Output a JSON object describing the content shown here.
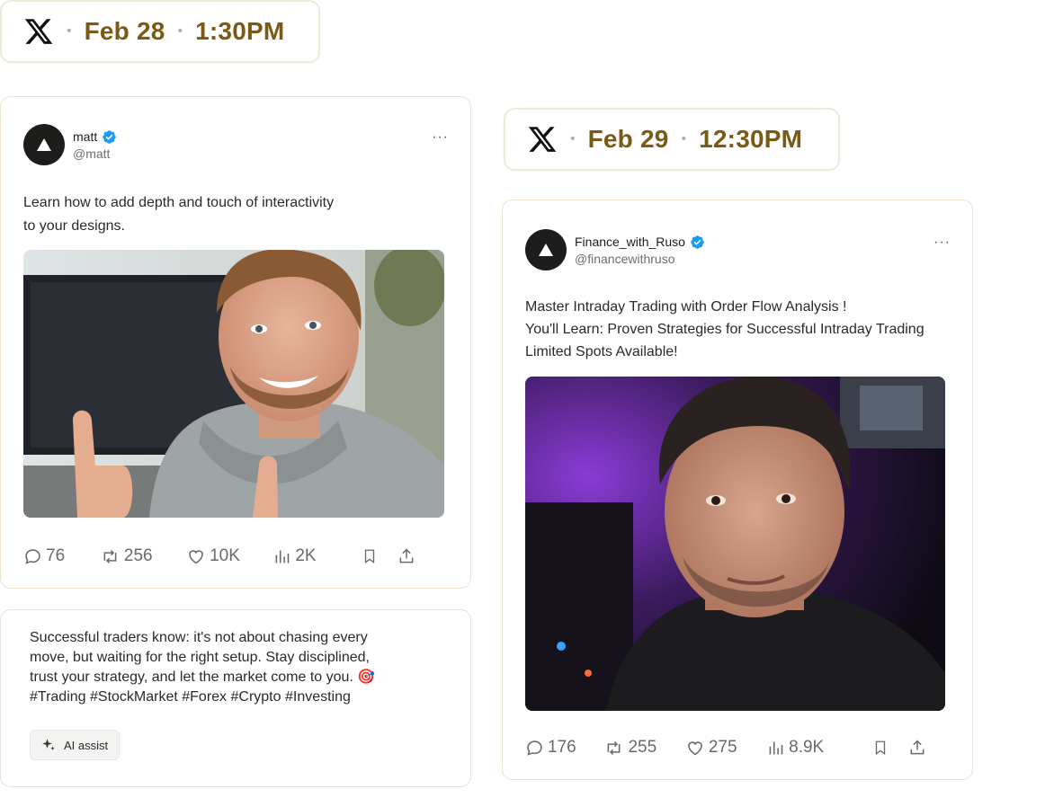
{
  "schedule": [
    {
      "date": "Feb 28",
      "time": "1:30PM"
    },
    {
      "date": "Feb 29",
      "time": "12:30PM"
    }
  ],
  "posts": [
    {
      "name": "matt",
      "handle": "@matt",
      "more": "···",
      "text": [
        "Learn how to add depth and touch of interactivity",
        "to your designs."
      ],
      "stats": {
        "replies": "76",
        "reposts": "256",
        "likes": "10K",
        "views": "2K"
      }
    },
    {
      "name": "Finance_with_Ruso",
      "handle": "@financewithruso",
      "more": "···",
      "text": [
        "Master Intraday Trading with Order Flow Analysis !",
        "You'll Learn: Proven Strategies for Successful Intraday Trading",
        "Limited Spots Available!"
      ],
      "stats": {
        "replies": "176",
        "reposts": "255",
        "likes": "275",
        "views": "8.9K"
      }
    }
  ],
  "compose": {
    "lines": [
      "Successful traders know: it's not about chasing every",
      "move, but waiting for the right setup. Stay disciplined,",
      "trust your strategy, and let the market come to you. 🎯",
      "#Trading #StockMarket #Forex #Crypto #Investing"
    ],
    "ai_assist_label": "AI assist"
  },
  "colors": {
    "accent_text": "#7a5a14",
    "verified": "#1d9bf0",
    "card_border": "#ece3cf"
  },
  "icons": [
    "x-logo-icon",
    "verified-badge-icon",
    "more-icon",
    "reply-icon",
    "repost-icon",
    "like-icon",
    "views-icon",
    "bookmark-icon",
    "share-icon",
    "sparkle-icon"
  ]
}
